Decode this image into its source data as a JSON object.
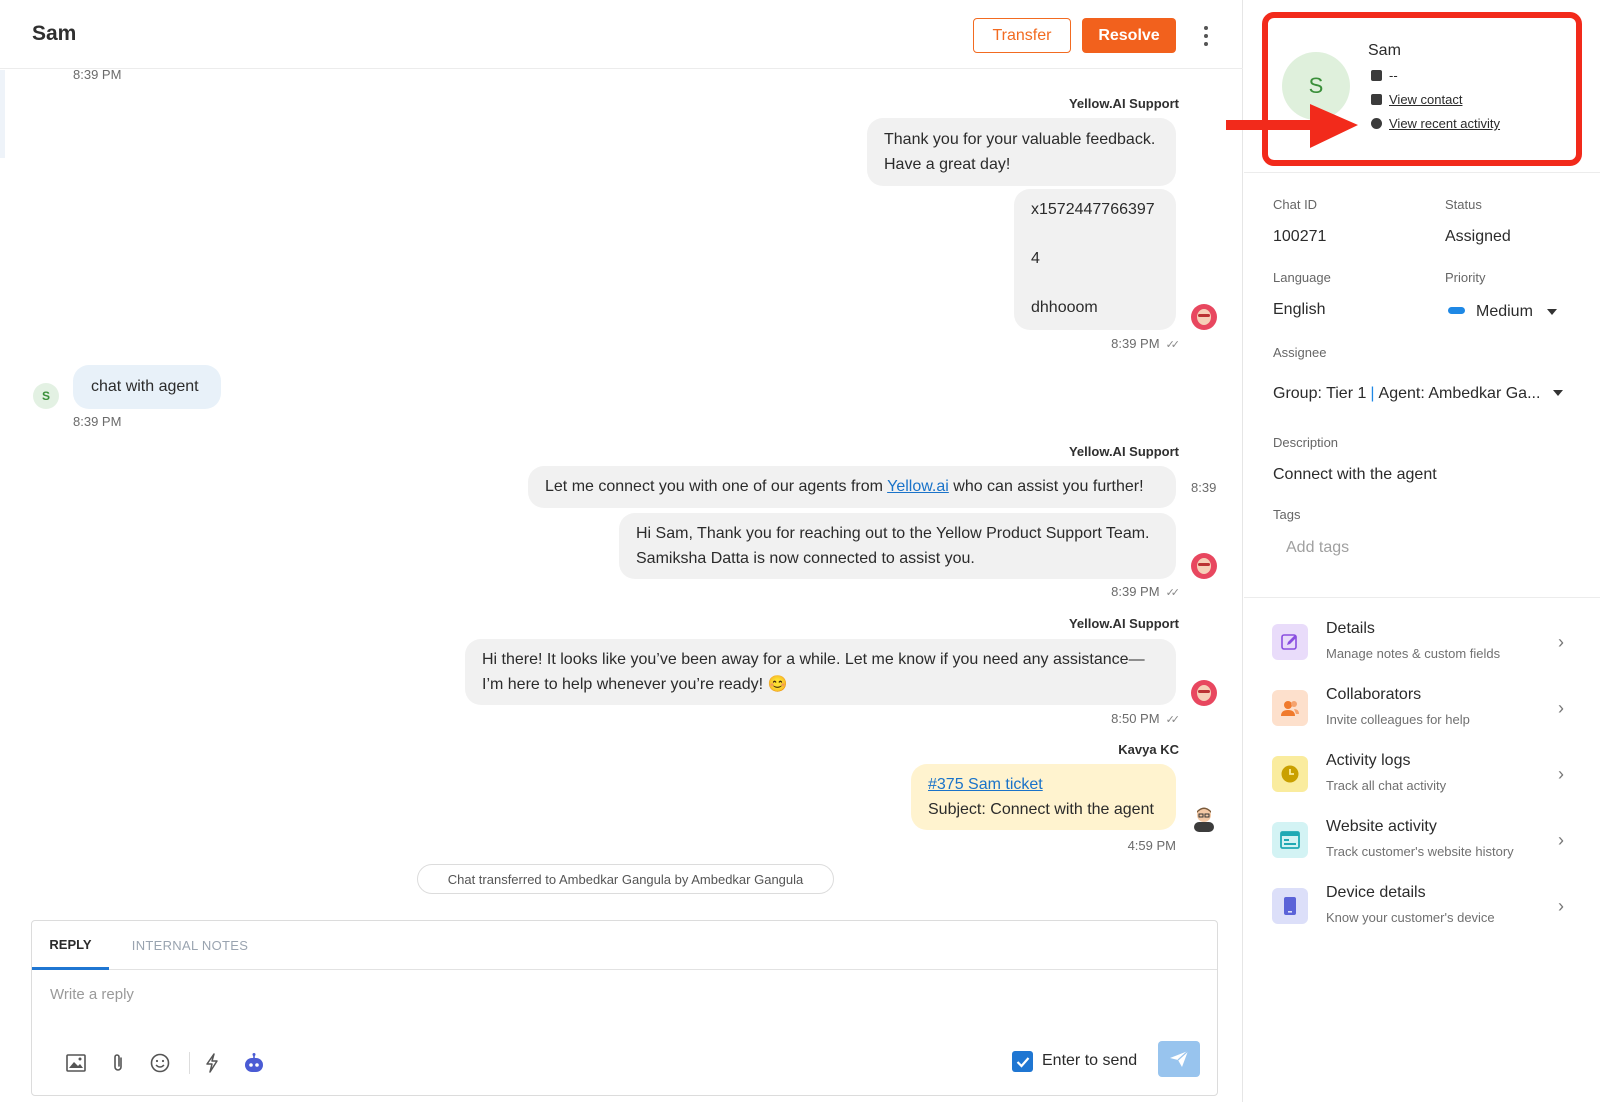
{
  "header": {
    "title": "Sam",
    "transfer_label": "Transfer",
    "resolve_label": "Resolve"
  },
  "messages": {
    "top_timestamp": "8:39 PM",
    "m1_sender": "Yellow.AI Support",
    "m1_line1": "Thank you for your valuable feedback.",
    "m1_line2": "Have a great day!",
    "m2_line1": "x1572447766397",
    "m2_line2": "4",
    "m2_line3": "dhhooom",
    "m2_time": "8:39 PM",
    "user_initial": "S",
    "user_msg": "chat with agent",
    "user_time": "8:39 PM",
    "m3_sender": "Yellow.AI Support",
    "m3_pre": "Let me connect you with one of our agents from ",
    "m3_link": "Yellow.ai",
    "m3_post": " who can assist you further!",
    "m3_time_short": "8:39",
    "m4_line1": "Hi Sam, Thank you for reaching out to the Yellow Product Support Team.",
    "m4_line2": "Samiksha Datta is now connected to assist you.",
    "m4_time": "8:39 PM",
    "m5_sender": "Yellow.AI Support",
    "m5_line1": "Hi there! It looks like you’ve been away for a while. Let me know if you need any assistance—",
    "m5_line2": "I’m here to help whenever you’re ready! 😊",
    "m5_time": "8:50 PM",
    "m6_sender": "Kavya KC",
    "m6_link": "#375 Sam ticket",
    "m6_subject": "Subject: Connect with the agent",
    "m6_time": "4:59 PM",
    "system_notice": "Chat transferred to Ambedkar Gangula by Ambedkar Gangula"
  },
  "composer": {
    "tab_reply": "REPLY",
    "tab_notes": "INTERNAL NOTES",
    "placeholder": "Write a reply",
    "enter_to_send": "Enter to send",
    "enter_to_send_checked": true
  },
  "profile": {
    "avatar_initial": "S",
    "name": "Sam",
    "id_value": "--",
    "view_contact": "View contact",
    "view_recent_activity": "View recent activity"
  },
  "details": {
    "chat_id_label": "Chat ID",
    "chat_id": "100271",
    "status_label": "Status",
    "status": "Assigned",
    "language_label": "Language",
    "language": "English",
    "priority_label": "Priority",
    "priority": "Medium",
    "assignee_label": "Assignee",
    "assignee_group": "Group: Tier 1",
    "assignee_agent": "Agent: Ambedkar Ga...",
    "description_label": "Description",
    "description": "Connect with the agent",
    "tags_label": "Tags",
    "tags_placeholder": "Add tags"
  },
  "menu": [
    {
      "title": "Details",
      "subtitle": "Manage notes & custom fields",
      "color": "#e9dcfa",
      "icon_color": "#8a4fe0"
    },
    {
      "title": "Collaborators",
      "subtitle": "Invite colleagues for help",
      "color": "#fde0cc",
      "icon_color": "#f07a2c"
    },
    {
      "title": "Activity logs",
      "subtitle": "Track all chat activity",
      "color": "#faec9e",
      "icon_color": "#c9a000"
    },
    {
      "title": "Website activity",
      "subtitle": "Track customer's website history",
      "color": "#d3f3f4",
      "icon_color": "#1fa9b4"
    },
    {
      "title": "Device details",
      "subtitle": "Know your customer's device",
      "color": "#dcdff9",
      "icon_color": "#5b63d8"
    }
  ],
  "colors": {
    "accent_orange": "#f2611d",
    "primary_blue": "#1f76d2",
    "highlight_red": "#f22a1b"
  }
}
